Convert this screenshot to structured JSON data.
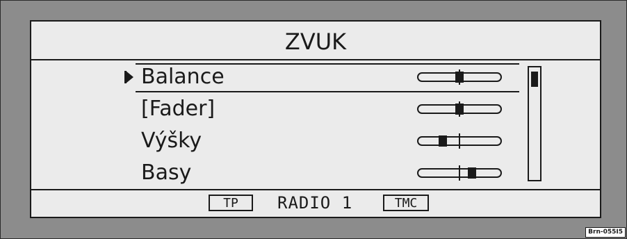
{
  "screen": {
    "title": "ZVUK",
    "menu": [
      {
        "label": "Balance",
        "selected": true,
        "level": 0.5
      },
      {
        "label": "[Fader]",
        "selected": false,
        "level": 0.5
      },
      {
        "label": "Výšky",
        "selected": false,
        "level": 0.3
      },
      {
        "label": "Basy",
        "selected": false,
        "level": 0.65
      }
    ],
    "scroll_position": 0.0
  },
  "status_bar": {
    "tp_label": "TP",
    "station": "RADIO 1",
    "tmc_label": "TMC"
  },
  "figure_code": "Brn-055I5"
}
